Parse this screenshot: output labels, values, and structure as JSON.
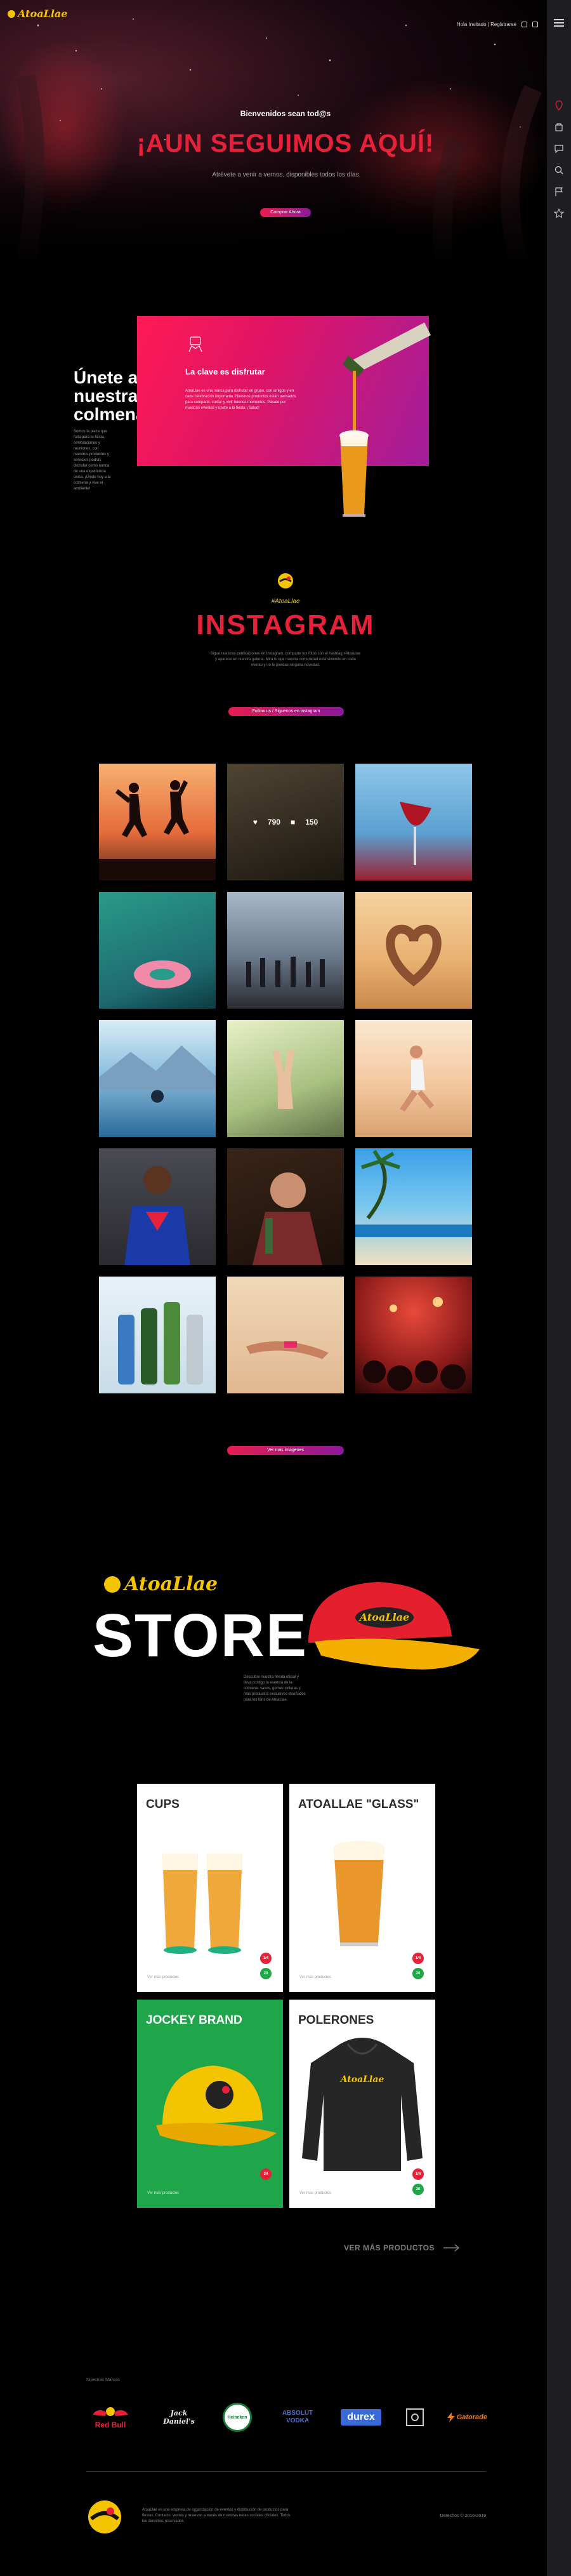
{
  "header": {
    "logo_text": "AtoaLlae",
    "nav_text": "Hola Invitado | Registrarse",
    "social_icons": [
      "facebook-icon",
      "instagram-icon"
    ]
  },
  "sidebar": {
    "icons": [
      "menu-icon",
      "pin-icon",
      "bag-icon",
      "chat-icon",
      "search-icon",
      "flag-icon",
      "star-icon"
    ]
  },
  "hero": {
    "welcome": "Bienvenidos sean tod@s",
    "title": "¡AUN SEGUIMOS AQUÍ!",
    "subtitle": "Atrévete a venir a vernos, disponibles todos los días",
    "button": "Comprar Ahora"
  },
  "join": {
    "title": "Únete a nuestra colmena",
    "text": "Somos la pieza que falta para tu fiesta, celebraciones y reuniones, con nuestros productos y servicios podrás disfrutar como nunca de una experiencia única. ¡Únete hoy a la colmena y vive el ambiente!",
    "card_title": "La clave es disfrutar",
    "card_text": "AtoaLlae es una marca para disfrutar en grupo, con amigos y en cada celebración importante. Nuestros productos están pensados para compartir, cuidar y vivir buenos momentos. Pásate por nuestros eventos y únete a la fiesta. ¡Salud!"
  },
  "instagram": {
    "handle": "#AtoaLlae",
    "title": "INSTAGRAM",
    "description": "Sigue nuestras publicaciones en Instagram, comparte tus fotos con el hashtag #AtoaLlae y aparece en nuestra galería. Mira lo que nuestra comunidad está viviendo en cada evento y no te pierdas ninguna novedad.",
    "follow_button": "Follow us / Siguenos en instagram",
    "likes": "790",
    "comments": "150",
    "more_button": "Ver más imagenes",
    "photos": [
      "jump-sunset",
      "friends-toast",
      "wine-glass",
      "pool-float",
      "beach-group",
      "heart-hands",
      "mountain-lake",
      "peace-sign",
      "jump-beach",
      "superman-shirt",
      "girl-bottle",
      "palm-beach",
      "beer-bottles",
      "sunbather",
      "concert-crowd"
    ]
  },
  "store": {
    "logo_text": "AtoaLlae",
    "title": "STORE",
    "text": "Descubre nuestra tienda oficial y lleva contigo la esencia de la colmena: vasos, gorras, poleras y más productos exclusivos diseñados para los fans de AtoaLlae.",
    "more": "VER MÁS PRODUCTOS",
    "products": [
      {
        "name": "CUPS",
        "footer": "Ver más productos",
        "badges": [
          "1/4",
          "20"
        ]
      },
      {
        "name": "ATOALLAE \"GLASS\"",
        "footer": "Ver más productos",
        "badges": [
          "1/4",
          "20"
        ]
      },
      {
        "name": "JOCKEY BRAND",
        "footer": "Ver más productos",
        "badges": [
          "24"
        ]
      },
      {
        "name": "POLERONES",
        "footer": "Ver más productos",
        "badges": [
          "1/4",
          "20"
        ]
      }
    ]
  },
  "brands": {
    "label": "Nuestras Marcas",
    "items": [
      "Red Bull",
      "Jack Daniel's",
      "Heineken",
      "ABSOLUT VODKA",
      "durex",
      "",
      "Gatorade"
    ]
  },
  "footer": {
    "text": "AtoaLlae es una empresa de organización de eventos y distribución de productos para fiestas. Contacto, ventas y reservas a través de nuestras redes sociales oficiales. Todos los derechos reservados.",
    "right": "Derechos © 2016-2019"
  },
  "colors": {
    "accent_red": "#e8213a",
    "brand_yellow": "#f5c400",
    "gradient_start": "#ff1a55",
    "gradient_end": "#a21e9c"
  }
}
